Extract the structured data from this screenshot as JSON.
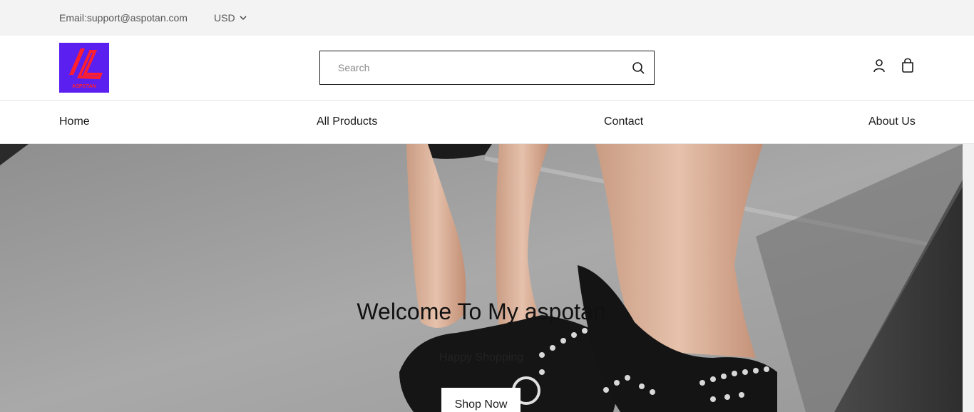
{
  "topbar": {
    "email": "Email:support@aspotan.com",
    "currency": "USD"
  },
  "header": {
    "logo_text": "ASPOTAN",
    "search_placeholder": "Search"
  },
  "nav": {
    "items": [
      "Home",
      "All Products",
      "Contact",
      "About Us"
    ]
  },
  "hero": {
    "title": "Welcome To My aspotan",
    "subtitle": "Happy Shopping",
    "button": "Shop Now"
  },
  "colors": {
    "logo_bg": "#5b1ff0",
    "logo_mark": "#ff1f2e",
    "topbar_bg": "#f3f3f3"
  },
  "icons": [
    "chevron-down-icon",
    "search-icon",
    "account-icon",
    "shopping-bag-icon"
  ]
}
